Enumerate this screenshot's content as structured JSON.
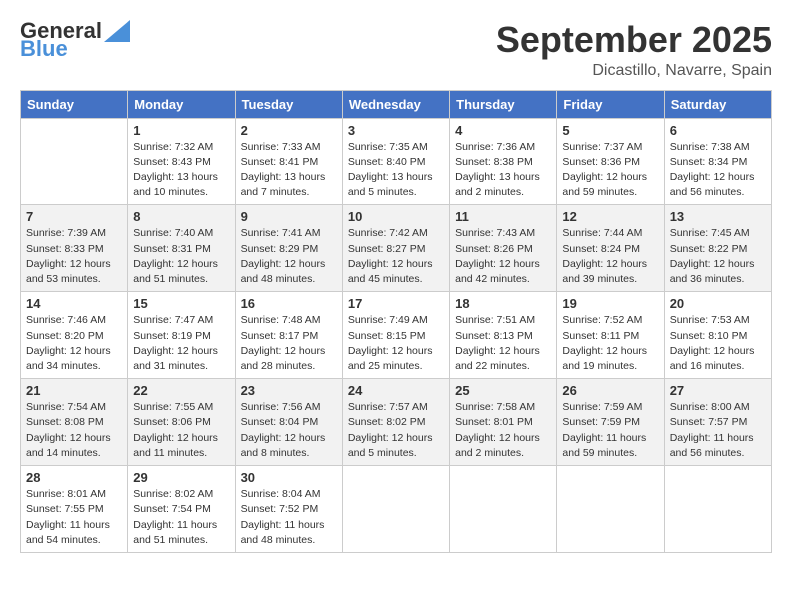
{
  "logo": {
    "general": "General",
    "blue": "Blue"
  },
  "header": {
    "month": "September 2025",
    "location": "Dicastillo, Navarre, Spain"
  },
  "weekdays": [
    "Sunday",
    "Monday",
    "Tuesday",
    "Wednesday",
    "Thursday",
    "Friday",
    "Saturday"
  ],
  "weeks": [
    [
      {
        "day": "",
        "sunrise": "",
        "sunset": "",
        "daylight": ""
      },
      {
        "day": "1",
        "sunrise": "Sunrise: 7:32 AM",
        "sunset": "Sunset: 8:43 PM",
        "daylight": "Daylight: 13 hours and 10 minutes."
      },
      {
        "day": "2",
        "sunrise": "Sunrise: 7:33 AM",
        "sunset": "Sunset: 8:41 PM",
        "daylight": "Daylight: 13 hours and 7 minutes."
      },
      {
        "day": "3",
        "sunrise": "Sunrise: 7:35 AM",
        "sunset": "Sunset: 8:40 PM",
        "daylight": "Daylight: 13 hours and 5 minutes."
      },
      {
        "day": "4",
        "sunrise": "Sunrise: 7:36 AM",
        "sunset": "Sunset: 8:38 PM",
        "daylight": "Daylight: 13 hours and 2 minutes."
      },
      {
        "day": "5",
        "sunrise": "Sunrise: 7:37 AM",
        "sunset": "Sunset: 8:36 PM",
        "daylight": "Daylight: 12 hours and 59 minutes."
      },
      {
        "day": "6",
        "sunrise": "Sunrise: 7:38 AM",
        "sunset": "Sunset: 8:34 PM",
        "daylight": "Daylight: 12 hours and 56 minutes."
      }
    ],
    [
      {
        "day": "7",
        "sunrise": "Sunrise: 7:39 AM",
        "sunset": "Sunset: 8:33 PM",
        "daylight": "Daylight: 12 hours and 53 minutes."
      },
      {
        "day": "8",
        "sunrise": "Sunrise: 7:40 AM",
        "sunset": "Sunset: 8:31 PM",
        "daylight": "Daylight: 12 hours and 51 minutes."
      },
      {
        "day": "9",
        "sunrise": "Sunrise: 7:41 AM",
        "sunset": "Sunset: 8:29 PM",
        "daylight": "Daylight: 12 hours and 48 minutes."
      },
      {
        "day": "10",
        "sunrise": "Sunrise: 7:42 AM",
        "sunset": "Sunset: 8:27 PM",
        "daylight": "Daylight: 12 hours and 45 minutes."
      },
      {
        "day": "11",
        "sunrise": "Sunrise: 7:43 AM",
        "sunset": "Sunset: 8:26 PM",
        "daylight": "Daylight: 12 hours and 42 minutes."
      },
      {
        "day": "12",
        "sunrise": "Sunrise: 7:44 AM",
        "sunset": "Sunset: 8:24 PM",
        "daylight": "Daylight: 12 hours and 39 minutes."
      },
      {
        "day": "13",
        "sunrise": "Sunrise: 7:45 AM",
        "sunset": "Sunset: 8:22 PM",
        "daylight": "Daylight: 12 hours and 36 minutes."
      }
    ],
    [
      {
        "day": "14",
        "sunrise": "Sunrise: 7:46 AM",
        "sunset": "Sunset: 8:20 PM",
        "daylight": "Daylight: 12 hours and 34 minutes."
      },
      {
        "day": "15",
        "sunrise": "Sunrise: 7:47 AM",
        "sunset": "Sunset: 8:19 PM",
        "daylight": "Daylight: 12 hours and 31 minutes."
      },
      {
        "day": "16",
        "sunrise": "Sunrise: 7:48 AM",
        "sunset": "Sunset: 8:17 PM",
        "daylight": "Daylight: 12 hours and 28 minutes."
      },
      {
        "day": "17",
        "sunrise": "Sunrise: 7:49 AM",
        "sunset": "Sunset: 8:15 PM",
        "daylight": "Daylight: 12 hours and 25 minutes."
      },
      {
        "day": "18",
        "sunrise": "Sunrise: 7:51 AM",
        "sunset": "Sunset: 8:13 PM",
        "daylight": "Daylight: 12 hours and 22 minutes."
      },
      {
        "day": "19",
        "sunrise": "Sunrise: 7:52 AM",
        "sunset": "Sunset: 8:11 PM",
        "daylight": "Daylight: 12 hours and 19 minutes."
      },
      {
        "day": "20",
        "sunrise": "Sunrise: 7:53 AM",
        "sunset": "Sunset: 8:10 PM",
        "daylight": "Daylight: 12 hours and 16 minutes."
      }
    ],
    [
      {
        "day": "21",
        "sunrise": "Sunrise: 7:54 AM",
        "sunset": "Sunset: 8:08 PM",
        "daylight": "Daylight: 12 hours and 14 minutes."
      },
      {
        "day": "22",
        "sunrise": "Sunrise: 7:55 AM",
        "sunset": "Sunset: 8:06 PM",
        "daylight": "Daylight: 12 hours and 11 minutes."
      },
      {
        "day": "23",
        "sunrise": "Sunrise: 7:56 AM",
        "sunset": "Sunset: 8:04 PM",
        "daylight": "Daylight: 12 hours and 8 minutes."
      },
      {
        "day": "24",
        "sunrise": "Sunrise: 7:57 AM",
        "sunset": "Sunset: 8:02 PM",
        "daylight": "Daylight: 12 hours and 5 minutes."
      },
      {
        "day": "25",
        "sunrise": "Sunrise: 7:58 AM",
        "sunset": "Sunset: 8:01 PM",
        "daylight": "Daylight: 12 hours and 2 minutes."
      },
      {
        "day": "26",
        "sunrise": "Sunrise: 7:59 AM",
        "sunset": "Sunset: 7:59 PM",
        "daylight": "Daylight: 11 hours and 59 minutes."
      },
      {
        "day": "27",
        "sunrise": "Sunrise: 8:00 AM",
        "sunset": "Sunset: 7:57 PM",
        "daylight": "Daylight: 11 hours and 56 minutes."
      }
    ],
    [
      {
        "day": "28",
        "sunrise": "Sunrise: 8:01 AM",
        "sunset": "Sunset: 7:55 PM",
        "daylight": "Daylight: 11 hours and 54 minutes."
      },
      {
        "day": "29",
        "sunrise": "Sunrise: 8:02 AM",
        "sunset": "Sunset: 7:54 PM",
        "daylight": "Daylight: 11 hours and 51 minutes."
      },
      {
        "day": "30",
        "sunrise": "Sunrise: 8:04 AM",
        "sunset": "Sunset: 7:52 PM",
        "daylight": "Daylight: 11 hours and 48 minutes."
      },
      {
        "day": "",
        "sunrise": "",
        "sunset": "",
        "daylight": ""
      },
      {
        "day": "",
        "sunrise": "",
        "sunset": "",
        "daylight": ""
      },
      {
        "day": "",
        "sunrise": "",
        "sunset": "",
        "daylight": ""
      },
      {
        "day": "",
        "sunrise": "",
        "sunset": "",
        "daylight": ""
      }
    ]
  ]
}
